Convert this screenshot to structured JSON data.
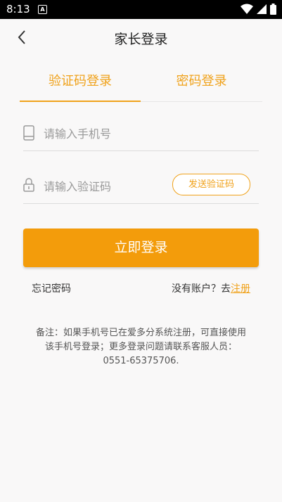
{
  "status_bar": {
    "time": "8:13",
    "notification_icon": "A"
  },
  "header": {
    "title": "家长登录",
    "back_icon": "back-arrow-icon"
  },
  "tabs": [
    {
      "label": "验证码登录",
      "active": true
    },
    {
      "label": "密码登录",
      "active": false
    }
  ],
  "form": {
    "phone": {
      "placeholder": "请输入手机号",
      "value": "",
      "icon": "phone-icon"
    },
    "code": {
      "placeholder": "请输入验证码",
      "value": "",
      "icon": "lock-icon"
    },
    "send_code_label": "发送验证码",
    "login_label": "立即登录"
  },
  "links": {
    "forgot_password": "忘记密码",
    "no_account": "没有账户？去",
    "register": "注册"
  },
  "note": "备注：如果手机号已在爱多分系统注册，可直接使用该手机号登录；更多登录问题请联系客服人员：0551-65375706.",
  "colors": {
    "accent": "#f39c0b",
    "tab_text": "#f0a21b",
    "background": "#f9f8f8"
  }
}
